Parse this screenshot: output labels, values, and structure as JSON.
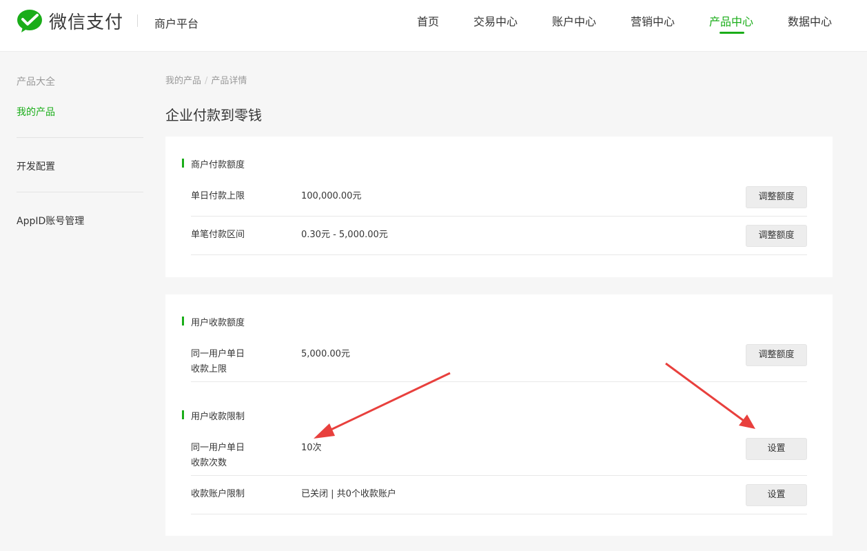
{
  "header": {
    "brand": "微信支付",
    "platform": "商户平台",
    "nav": [
      "首页",
      "交易中心",
      "账户中心",
      "营销中心",
      "产品中心",
      "数据中心"
    ],
    "active_nav": "产品中心"
  },
  "sidebar": {
    "group_label": "产品大全",
    "my_products": "我的产品",
    "dev_config": "开发配置",
    "appid_mgmt": "AppID账号管理"
  },
  "breadcrumb": {
    "parent": "我的产品",
    "separator": "/",
    "current": "产品详情"
  },
  "page_title": "企业付款到零钱",
  "merchant_quota": {
    "title": "商户付款额度",
    "rows": [
      {
        "label": "单日付款上限",
        "value": "100,000.00元",
        "button": "调整额度"
      },
      {
        "label": "单笔付款区间",
        "value": "0.30元 - 5,000.00元",
        "button": "调整额度"
      }
    ]
  },
  "user_quota": {
    "title": "用户收款额度",
    "rows": [
      {
        "label_line1": "同一用户单日",
        "label_line2": "收款上限",
        "value": "5,000.00元",
        "button": "调整额度"
      }
    ]
  },
  "user_limits": {
    "title": "用户收款限制",
    "rows": [
      {
        "label_line1": "同一用户单日",
        "label_line2": "收款次数",
        "value": "10次",
        "button": "设置"
      },
      {
        "label": "收款账户限制",
        "value": "已关闭 | 共0个收款账户",
        "button": "设置"
      }
    ]
  },
  "colors": {
    "accent": "#1aad19",
    "annotation_arrow": "#e8403d"
  },
  "icons": {
    "logo": "wechat-pay-logo-icon"
  }
}
